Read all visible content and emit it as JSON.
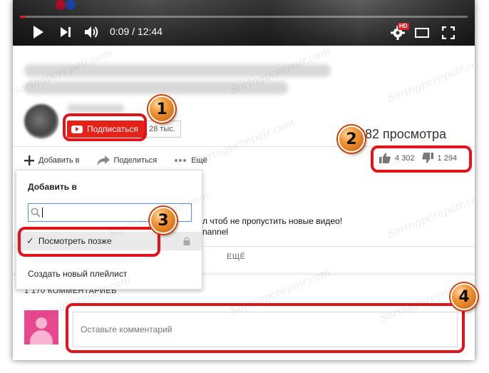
{
  "player": {
    "time_current": "0:09",
    "time_total": "12:44",
    "time_separator": " / ",
    "hd_badge": "HD",
    "progress": 0.012
  },
  "channel": {
    "subscribe_label": "Подписаться",
    "subscriber_count": "28 тыс."
  },
  "stats": {
    "views": "282 просмотра",
    "likes": "4 302",
    "dislikes": "1 294",
    "like_ratio": 0.77
  },
  "actions": {
    "add_to": "Добавить в",
    "share": "Поделиться",
    "more": "Ещё"
  },
  "description": {
    "line1": "л чтоб не пропустить новые видео!",
    "line2": "nannel",
    "show_more": "ЕЩЁ"
  },
  "comments": {
    "title": "1 170 КОММЕНТАРИЕВ",
    "placeholder": "Оставьте комментарий"
  },
  "dropdown": {
    "title": "Добавить в",
    "search_value": "",
    "watch_later": "Посмотреть позже",
    "create_playlist": "Создать новый плейлист"
  },
  "annotations": {
    "badge1": "1",
    "badge2": "2",
    "badge3": "3",
    "badge4": "4"
  },
  "watermark": "Soringpcrepair.com",
  "colors": {
    "highlight": "#e1141b",
    "youtube_red": "#e62117",
    "badge_orange": "#f49a3a"
  }
}
